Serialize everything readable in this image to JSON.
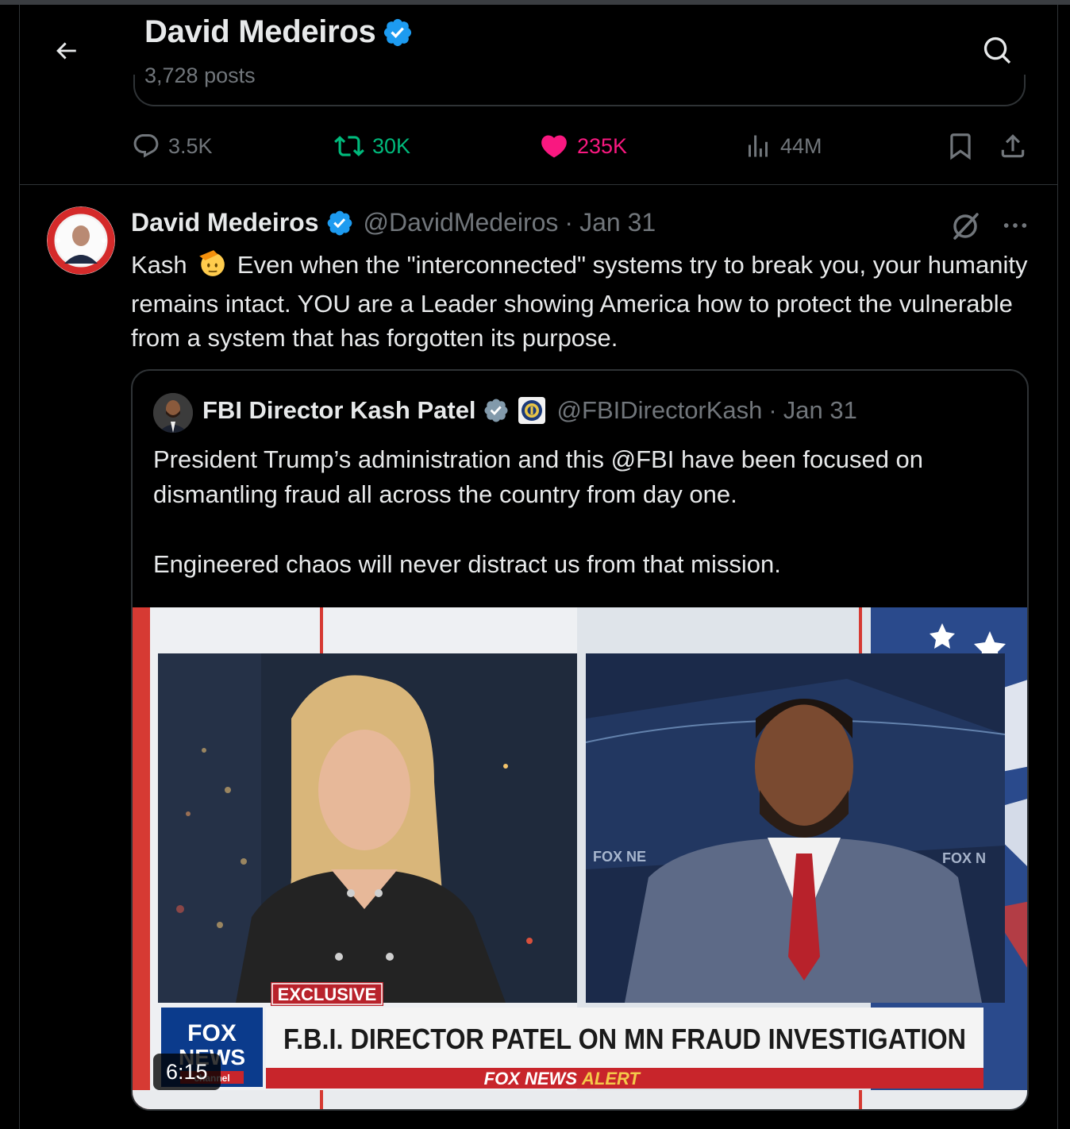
{
  "header": {
    "title": "David Medeiros",
    "post_count": "3,728 posts"
  },
  "prev_actions": {
    "replies": "3.5K",
    "reposts": "30K",
    "likes": "235K",
    "views": "44M"
  },
  "tweet": {
    "author_name": "David Medeiros",
    "handle": "@DavidMedeiros",
    "separator": "·",
    "date": "Jan 31",
    "text_before_emoji": "Kash",
    "emoji": "saluting-face",
    "text_after_emoji": "Even when the \"interconnected\" systems try to break you, your humanity remains intact. YOU are a Leader showing America how to protect the vulnerable from a system that has forgotten its purpose."
  },
  "quote": {
    "author_name": "FBI Director Kash Patel",
    "handle": "@FBIDirectorKash",
    "separator": "·",
    "date": "Jan 31",
    "paragraph1": "President Trump’s administration and this @FBI have been focused on dismantling fraud all across the country from day one.",
    "paragraph2": "Engineered chaos will never distract us from that mission.",
    "video": {
      "duration": "6:15",
      "badge": "EXCLUSIVE",
      "headline": "F.B.I. DIRECTOR PATEL ON MN FRAUD INVESTIGATION",
      "ticker_brand": "FOX NEWS",
      "ticker_alert": "ALERT",
      "logo_top": "FOX",
      "logo_bottom": "NEWS",
      "logo_channel": "channel",
      "bug_left": "FOX NE",
      "bug_right": "FOX N"
    }
  },
  "colors": {
    "background": "#000000",
    "text": "#e7e9ea",
    "muted": "#71767b",
    "border": "#2f3336",
    "verified": "#1d9bf0",
    "repost": "#00ba7c",
    "like": "#f91880",
    "gov_badge": "#829aab"
  },
  "icons": {
    "back": "back-arrow-icon",
    "search": "search-icon",
    "reply": "reply-icon",
    "repost": "repost-icon",
    "like": "heart-icon",
    "views": "views-icon",
    "bookmark": "bookmark-icon",
    "share": "share-icon",
    "grok": "grok-icon",
    "more": "more-icon"
  }
}
